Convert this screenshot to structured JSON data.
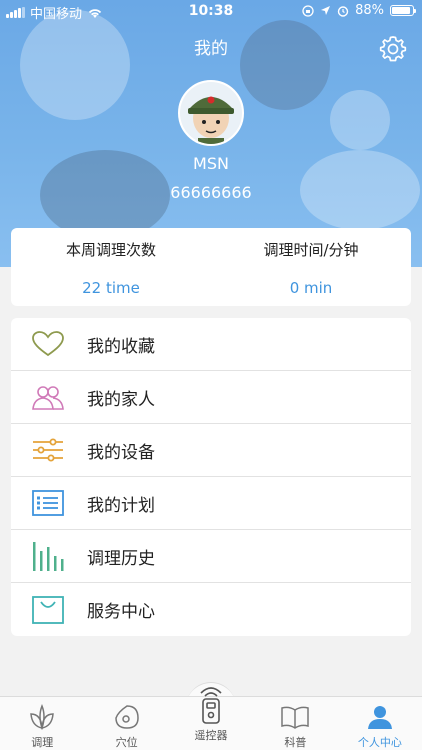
{
  "status_bar": {
    "carrier": "中国移动",
    "time": "10:38",
    "battery": "88%",
    "battery_level": 0.88
  },
  "header": {
    "title": "我的"
  },
  "profile": {
    "name": "MSN",
    "id": "66666666"
  },
  "stats": [
    {
      "label": "本周调理次数",
      "value": "22 time"
    },
    {
      "label": "调理时间/分钟",
      "value": "0 min"
    }
  ],
  "menu": [
    {
      "label": "我的收藏",
      "icon": "heart-icon",
      "color": "#8e9a4e"
    },
    {
      "label": "我的家人",
      "icon": "family-icon",
      "color": "#d07ab8"
    },
    {
      "label": "我的设备",
      "icon": "sliders-icon",
      "color": "#e4a33a"
    },
    {
      "label": "我的计划",
      "icon": "list-icon",
      "color": "#3f94de"
    },
    {
      "label": "调理历史",
      "icon": "bars-icon",
      "color": "#4fb08c"
    },
    {
      "label": "服务中心",
      "icon": "bag-icon",
      "color": "#3fb3b5"
    }
  ],
  "tabs": [
    {
      "label": "调理",
      "icon": "leaf-icon"
    },
    {
      "label": "穴位",
      "icon": "acupoint-icon"
    },
    {
      "label": "遥控器",
      "icon": "remote-icon"
    },
    {
      "label": "科普",
      "icon": "book-icon"
    },
    {
      "label": "个人中心",
      "icon": "person-icon",
      "active": true
    }
  ],
  "colors": {
    "accent": "#3f94de",
    "header": "#6aa8e6",
    "background": "#f2f2f2"
  }
}
